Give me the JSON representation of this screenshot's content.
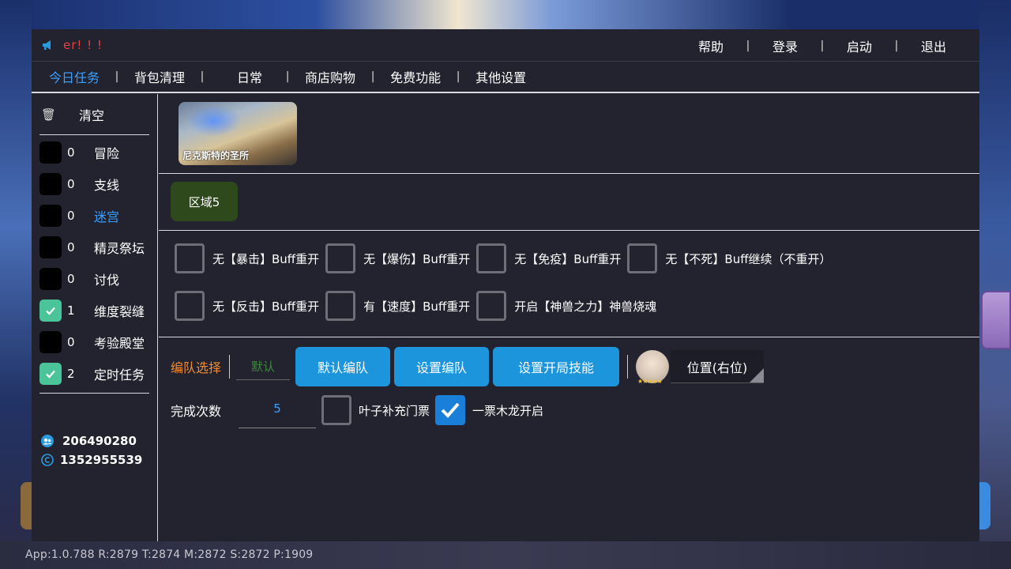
{
  "title": {
    "text": "er! ! !"
  },
  "top_menu": [
    "帮助",
    "登录",
    "启动",
    "退出"
  ],
  "menu_separator": "|",
  "tabs": [
    "今日任务",
    "背包清理",
    "日常",
    "商店购物",
    "免费功能",
    "其他设置"
  ],
  "active_tab": "今日任务",
  "sidebar": {
    "clear_label": "清空",
    "items": [
      {
        "count": "0",
        "label": "冒险",
        "checked": false
      },
      {
        "count": "0",
        "label": "支线",
        "checked": false
      },
      {
        "count": "0",
        "label": "迷宫",
        "checked": false,
        "active": true
      },
      {
        "count": "0",
        "label": "精灵祭坛",
        "checked": false
      },
      {
        "count": "0",
        "label": "讨伐",
        "checked": false
      },
      {
        "count": "1",
        "label": "维度裂缝",
        "checked": true
      },
      {
        "count": "0",
        "label": "考验殿堂",
        "checked": false
      },
      {
        "count": "2",
        "label": "定时任务",
        "checked": true
      }
    ],
    "contacts": [
      {
        "icon": "qq-group-icon",
        "text": "206490280"
      },
      {
        "icon": "copyright-icon",
        "text": "1352955539"
      }
    ]
  },
  "map": {
    "caption": "尼克斯特的圣所"
  },
  "area_button": "区域5",
  "options": {
    "row1": [
      {
        "label": "无【暴击】Buff重开",
        "checked": false
      },
      {
        "label": "无【爆伤】Buff重开",
        "checked": false
      },
      {
        "label": "无【免疫】Buff重开",
        "checked": false
      },
      {
        "label": "无【不死】Buff继续（不重开）",
        "checked": false
      }
    ],
    "row2": [
      {
        "label": "无【反击】Buff重开",
        "checked": false
      },
      {
        "label": "有【速度】Buff重开",
        "checked": false
      },
      {
        "label": "开启【神兽之力】神兽烧魂",
        "checked": false
      }
    ]
  },
  "team": {
    "label": "编队选择",
    "input_value": "默认",
    "buttons": [
      "默认编队",
      "设置编队",
      "设置开局技能"
    ],
    "avatar_stars": "★★★★★",
    "position": "位置(右位)"
  },
  "count": {
    "label": "完成次数",
    "value": "5",
    "leaf_ticket": {
      "label": "叶子补充门票",
      "checked": false
    },
    "one_ticket": {
      "label": "一票木龙开启",
      "checked": true
    }
  },
  "status_bar": "App:1.0.788  R:2879 T:2874 M:2872 S:2872 P:1909",
  "colors": {
    "window_bg": "#23232f",
    "accent_blue": "#3aa0ff",
    "button_blue": "#1d95dc",
    "check_green": "#4cc49a",
    "orange_label": "#f08a30",
    "title_red": "#e84040",
    "area_green": "#2e4a1c"
  }
}
